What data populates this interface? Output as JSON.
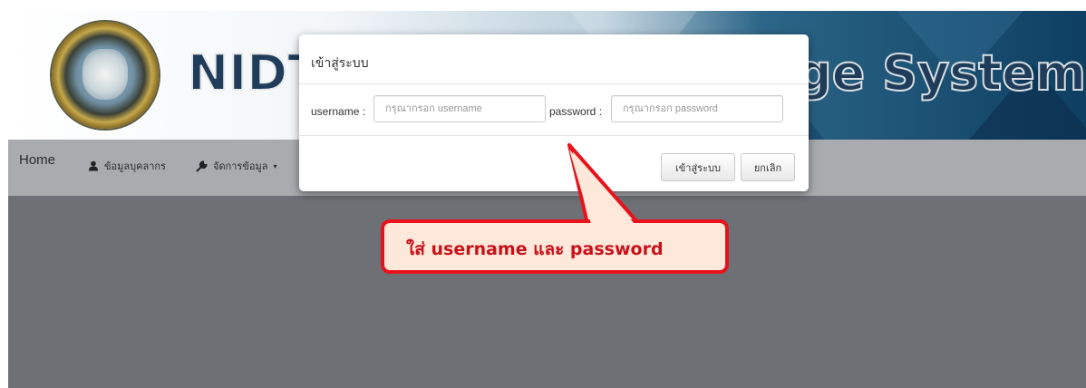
{
  "banner": {
    "title_left": "NIDT",
    "title_right": "ge System"
  },
  "nav": {
    "items": [
      {
        "label": "Home"
      },
      {
        "label": "ข้อมูลบุคลากร",
        "icon": "user-icon"
      },
      {
        "label": "จัดการข้อมูล",
        "icon": "wrench-icon"
      }
    ]
  },
  "modal": {
    "title": "เข้าสู่ระบบ",
    "username_label": "username :",
    "username_placeholder": "กรุณากรอก username",
    "password_label": "password :",
    "password_placeholder": "กรุณากรอก password",
    "login_button": "เข้าสู่ระบบ",
    "cancel_button": "ยกเลิก"
  },
  "callout": {
    "text": "ใส่ username และ password"
  },
  "colors": {
    "callout_border": "#e8121c",
    "callout_fill": "#fde8d9",
    "callout_text": "#c8121a",
    "overlay": "#6d7175"
  }
}
